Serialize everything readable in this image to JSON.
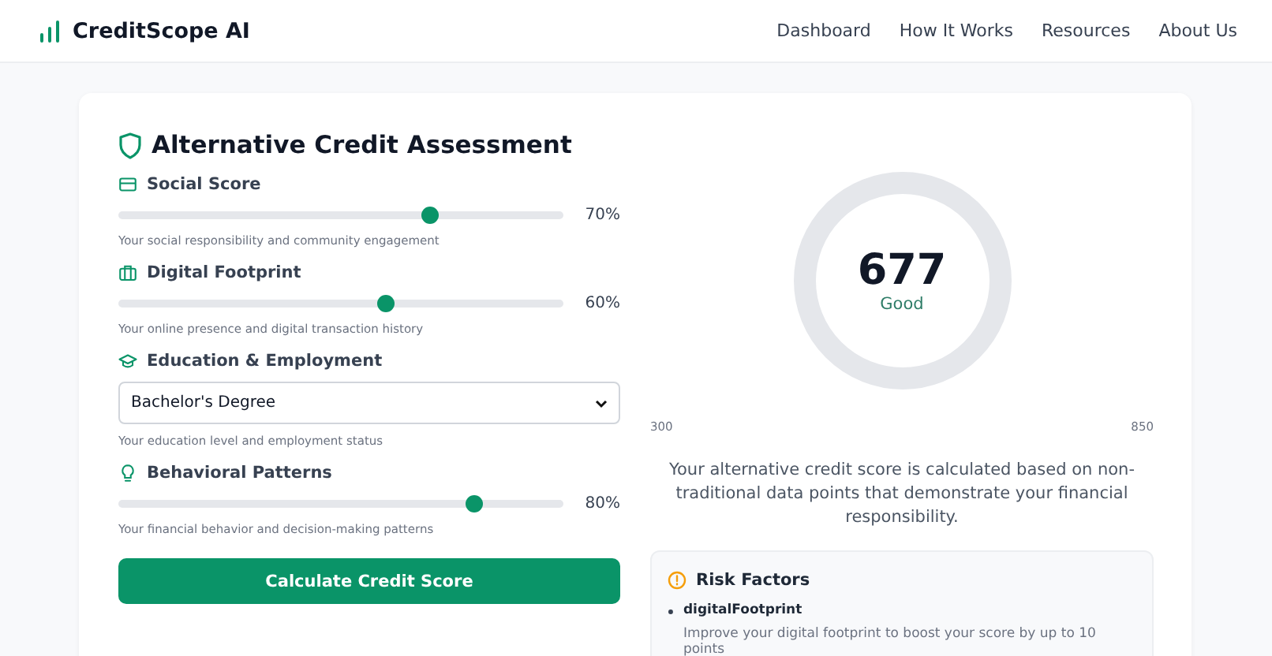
{
  "header": {
    "brand": "CreditScope AI",
    "nav": [
      {
        "label": "Dashboard"
      },
      {
        "label": "How It Works"
      },
      {
        "label": "Resources"
      },
      {
        "label": "About Us"
      }
    ]
  },
  "assessment": {
    "title": "Alternative Credit Assessment",
    "factors": [
      {
        "kind": "slider",
        "label": "Social Score",
        "level": 0.7,
        "reading": "70%",
        "hint": "Your social responsibility and community engagement"
      },
      {
        "kind": "slider",
        "label": "Digital Footprint",
        "level": 0.6,
        "reading": "60%",
        "hint": "Your online presence and digital transaction history"
      },
      {
        "kind": "select",
        "label": "Education & Employment",
        "value": "Bachelor's Degree",
        "hint": "Your education level and employment status"
      },
      {
        "kind": "slider",
        "label": "Behavioral Patterns",
        "level": 0.8,
        "reading": "80%",
        "hint": "Your financial behavior and decision-making patterns"
      }
    ],
    "button": "Calculate Credit Score"
  },
  "result": {
    "score": "677",
    "rating": "Good",
    "min": "300",
    "max": "850",
    "explanation": "Your alternative credit score is calculated based on non-traditional data points that demonstrate your financial responsibility.",
    "risk_factors": {
      "title": "Risk Factors",
      "items": [
        {
          "name": "digitalFootprint",
          "advice": "Improve your digital footprint to boost your score by up to 10 points"
        }
      ]
    }
  }
}
